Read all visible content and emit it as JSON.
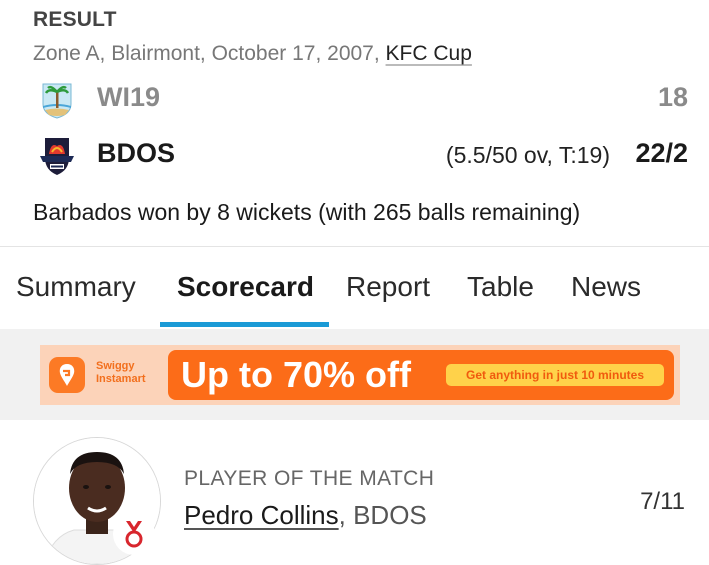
{
  "header": {
    "status": "RESULT",
    "match_info": "Zone A, Blairmont, October 17, 2007,",
    "series_link": "KFC Cup"
  },
  "teams": [
    {
      "name": "WI19",
      "score": "18",
      "overs": "",
      "logo_icon": "west-indies-logo-icon"
    },
    {
      "name": "BDOS",
      "score": "22/2",
      "overs": "(5.5/50 ov, T:19)",
      "logo_icon": "barbados-pride-logo-icon"
    }
  ],
  "result_text": "Barbados won by 8 wickets (with 265 balls remaining)",
  "tabs": [
    {
      "label": "Summary",
      "active": false
    },
    {
      "label": "Scorecard",
      "active": true
    },
    {
      "label": "Report",
      "active": false
    },
    {
      "label": "Table",
      "active": false
    },
    {
      "label": "News",
      "active": false
    }
  ],
  "ad": {
    "brand_line1": "Swiggy",
    "brand_line2": "Instamart",
    "headline": "Up to 70% off",
    "subtext": "Get anything in just 10 minutes"
  },
  "player_of_match": {
    "label": "PLAYER OF THE MATCH",
    "name": "Pedro Collins",
    "team": ", BDOS",
    "figures": "7/11"
  },
  "colors": {
    "accent": "#1a9ad6",
    "ad_orange": "#fc6c18",
    "ad_yellow": "#ffd24a",
    "medal_red": "#d8262d"
  }
}
